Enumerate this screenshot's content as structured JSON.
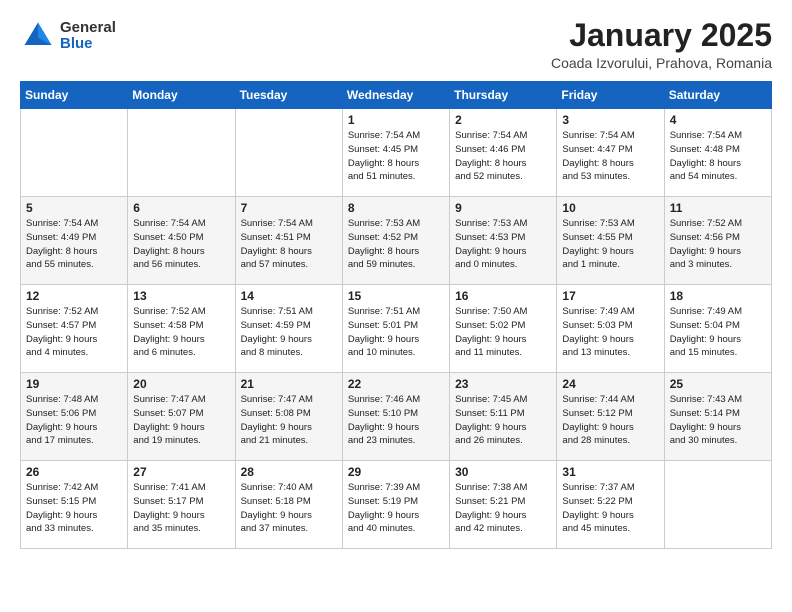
{
  "header": {
    "logo_general": "General",
    "logo_blue": "Blue",
    "title": "January 2025",
    "location": "Coada Izvorului, Prahova, Romania"
  },
  "weekdays": [
    "Sunday",
    "Monday",
    "Tuesday",
    "Wednesday",
    "Thursday",
    "Friday",
    "Saturday"
  ],
  "weeks": [
    [
      {
        "day": "",
        "info": ""
      },
      {
        "day": "",
        "info": ""
      },
      {
        "day": "",
        "info": ""
      },
      {
        "day": "1",
        "info": "Sunrise: 7:54 AM\nSunset: 4:45 PM\nDaylight: 8 hours\nand 51 minutes."
      },
      {
        "day": "2",
        "info": "Sunrise: 7:54 AM\nSunset: 4:46 PM\nDaylight: 8 hours\nand 52 minutes."
      },
      {
        "day": "3",
        "info": "Sunrise: 7:54 AM\nSunset: 4:47 PM\nDaylight: 8 hours\nand 53 minutes."
      },
      {
        "day": "4",
        "info": "Sunrise: 7:54 AM\nSunset: 4:48 PM\nDaylight: 8 hours\nand 54 minutes."
      }
    ],
    [
      {
        "day": "5",
        "info": "Sunrise: 7:54 AM\nSunset: 4:49 PM\nDaylight: 8 hours\nand 55 minutes."
      },
      {
        "day": "6",
        "info": "Sunrise: 7:54 AM\nSunset: 4:50 PM\nDaylight: 8 hours\nand 56 minutes."
      },
      {
        "day": "7",
        "info": "Sunrise: 7:54 AM\nSunset: 4:51 PM\nDaylight: 8 hours\nand 57 minutes."
      },
      {
        "day": "8",
        "info": "Sunrise: 7:53 AM\nSunset: 4:52 PM\nDaylight: 8 hours\nand 59 minutes."
      },
      {
        "day": "9",
        "info": "Sunrise: 7:53 AM\nSunset: 4:53 PM\nDaylight: 9 hours\nand 0 minutes."
      },
      {
        "day": "10",
        "info": "Sunrise: 7:53 AM\nSunset: 4:55 PM\nDaylight: 9 hours\nand 1 minute."
      },
      {
        "day": "11",
        "info": "Sunrise: 7:52 AM\nSunset: 4:56 PM\nDaylight: 9 hours\nand 3 minutes."
      }
    ],
    [
      {
        "day": "12",
        "info": "Sunrise: 7:52 AM\nSunset: 4:57 PM\nDaylight: 9 hours\nand 4 minutes."
      },
      {
        "day": "13",
        "info": "Sunrise: 7:52 AM\nSunset: 4:58 PM\nDaylight: 9 hours\nand 6 minutes."
      },
      {
        "day": "14",
        "info": "Sunrise: 7:51 AM\nSunset: 4:59 PM\nDaylight: 9 hours\nand 8 minutes."
      },
      {
        "day": "15",
        "info": "Sunrise: 7:51 AM\nSunset: 5:01 PM\nDaylight: 9 hours\nand 10 minutes."
      },
      {
        "day": "16",
        "info": "Sunrise: 7:50 AM\nSunset: 5:02 PM\nDaylight: 9 hours\nand 11 minutes."
      },
      {
        "day": "17",
        "info": "Sunrise: 7:49 AM\nSunset: 5:03 PM\nDaylight: 9 hours\nand 13 minutes."
      },
      {
        "day": "18",
        "info": "Sunrise: 7:49 AM\nSunset: 5:04 PM\nDaylight: 9 hours\nand 15 minutes."
      }
    ],
    [
      {
        "day": "19",
        "info": "Sunrise: 7:48 AM\nSunset: 5:06 PM\nDaylight: 9 hours\nand 17 minutes."
      },
      {
        "day": "20",
        "info": "Sunrise: 7:47 AM\nSunset: 5:07 PM\nDaylight: 9 hours\nand 19 minutes."
      },
      {
        "day": "21",
        "info": "Sunrise: 7:47 AM\nSunset: 5:08 PM\nDaylight: 9 hours\nand 21 minutes."
      },
      {
        "day": "22",
        "info": "Sunrise: 7:46 AM\nSunset: 5:10 PM\nDaylight: 9 hours\nand 23 minutes."
      },
      {
        "day": "23",
        "info": "Sunrise: 7:45 AM\nSunset: 5:11 PM\nDaylight: 9 hours\nand 26 minutes."
      },
      {
        "day": "24",
        "info": "Sunrise: 7:44 AM\nSunset: 5:12 PM\nDaylight: 9 hours\nand 28 minutes."
      },
      {
        "day": "25",
        "info": "Sunrise: 7:43 AM\nSunset: 5:14 PM\nDaylight: 9 hours\nand 30 minutes."
      }
    ],
    [
      {
        "day": "26",
        "info": "Sunrise: 7:42 AM\nSunset: 5:15 PM\nDaylight: 9 hours\nand 33 minutes."
      },
      {
        "day": "27",
        "info": "Sunrise: 7:41 AM\nSunset: 5:17 PM\nDaylight: 9 hours\nand 35 minutes."
      },
      {
        "day": "28",
        "info": "Sunrise: 7:40 AM\nSunset: 5:18 PM\nDaylight: 9 hours\nand 37 minutes."
      },
      {
        "day": "29",
        "info": "Sunrise: 7:39 AM\nSunset: 5:19 PM\nDaylight: 9 hours\nand 40 minutes."
      },
      {
        "day": "30",
        "info": "Sunrise: 7:38 AM\nSunset: 5:21 PM\nDaylight: 9 hours\nand 42 minutes."
      },
      {
        "day": "31",
        "info": "Sunrise: 7:37 AM\nSunset: 5:22 PM\nDaylight: 9 hours\nand 45 minutes."
      },
      {
        "day": "",
        "info": ""
      }
    ]
  ]
}
